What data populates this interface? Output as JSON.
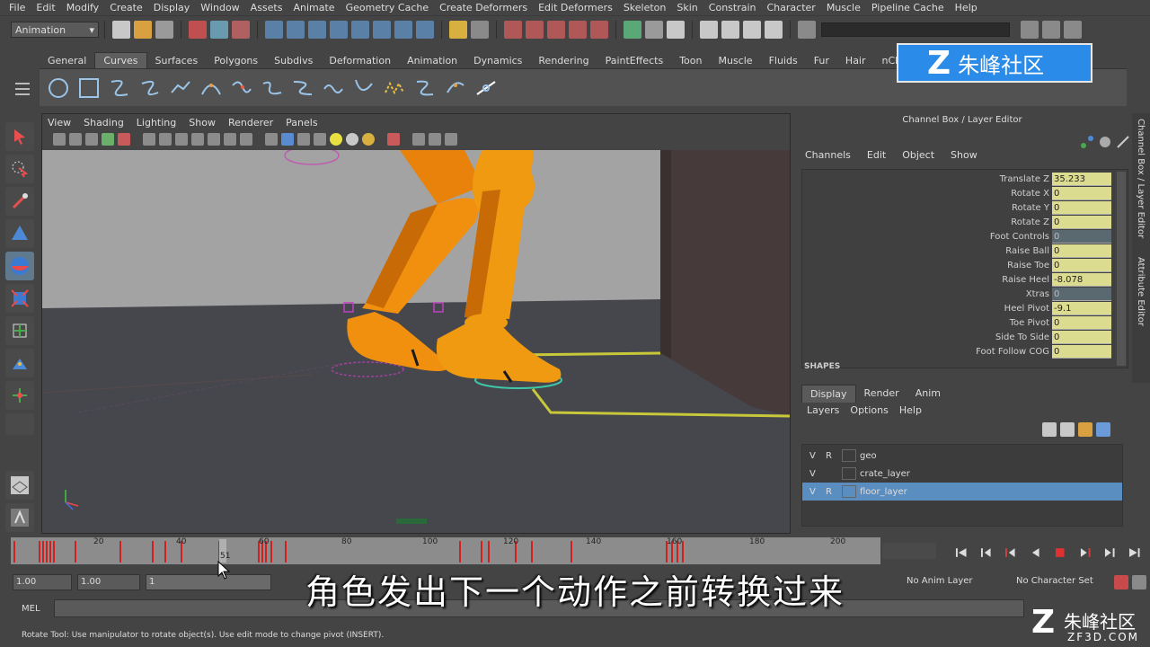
{
  "menubar": [
    "File",
    "Edit",
    "Modify",
    "Create",
    "Display",
    "Window",
    "Assets",
    "Animate",
    "Geometry Cache",
    "Create Deformers",
    "Edit Deformers",
    "Skeleton",
    "Skin",
    "Constrain",
    "Character",
    "Muscle",
    "Pipeline Cache",
    "Help"
  ],
  "statusline": {
    "mode": "Animation"
  },
  "shelf": {
    "tabs": [
      "General",
      "Curves",
      "Surfaces",
      "Polygons",
      "Subdivs",
      "Deformation",
      "Animation",
      "Dynamics",
      "Rendering",
      "PaintEffects",
      "Toon",
      "Muscle",
      "Fluids",
      "Fur",
      "Hair",
      "nClo"
    ],
    "active_tab": "Curves"
  },
  "logo": {
    "glyph": "Z",
    "text": "朱峰社区"
  },
  "viewport": {
    "menu": [
      "View",
      "Shading",
      "Lighting",
      "Show",
      "Renderer",
      "Panels"
    ]
  },
  "channel_box": {
    "title": "Channel Box / Layer Editor",
    "menu": [
      "Channels",
      "Edit",
      "Object",
      "Show"
    ],
    "attributes": [
      {
        "name": "Translate Z",
        "value": "35.233",
        "style": "key"
      },
      {
        "name": "Rotate X",
        "value": "0",
        "style": "key"
      },
      {
        "name": "Rotate Y",
        "value": "0",
        "style": "key"
      },
      {
        "name": "Rotate Z",
        "value": "0",
        "style": "key"
      },
      {
        "name": "Foot Controls",
        "value": "0",
        "style": "locked"
      },
      {
        "name": "Raise Ball",
        "value": "0",
        "style": "key"
      },
      {
        "name": "Raise Toe",
        "value": "0",
        "style": "key"
      },
      {
        "name": "Raise Heel",
        "value": "-8.078",
        "style": "key"
      },
      {
        "name": "Xtras",
        "value": "0",
        "style": "locked"
      },
      {
        "name": "Heel Pivot",
        "value": "-9.1",
        "style": "key"
      },
      {
        "name": "Toe Pivot",
        "value": "0",
        "style": "key"
      },
      {
        "name": "Side To Side",
        "value": "0",
        "style": "key"
      },
      {
        "name": "Foot Follow COG",
        "value": "0",
        "style": "key"
      }
    ],
    "shapes_label": "SHAPES"
  },
  "layer_editor": {
    "tabs": [
      "Display",
      "Render",
      "Anim"
    ],
    "active_tab": "Display",
    "menu": [
      "Layers",
      "Options",
      "Help"
    ],
    "layers": [
      {
        "v": "V",
        "r": "R",
        "name": "geo",
        "selected": false
      },
      {
        "v": "V",
        "r": "",
        "name": "crate_layer",
        "selected": false
      },
      {
        "v": "V",
        "r": "R",
        "name": "floor_layer",
        "selected": true
      }
    ]
  },
  "side_tabs": [
    "Channel Box / Layer Editor",
    "Attribute Editor"
  ],
  "timeslider": {
    "ticks": [
      "20",
      "40",
      "60",
      "80",
      "100",
      "120",
      "140",
      "160",
      "180",
      "200"
    ],
    "current_frame": "51"
  },
  "rangebar": {
    "start": "1.00",
    "playback_start": "1.00",
    "range_start": "1",
    "anim_layer": "No Anim Layer",
    "character_set": "No Character Set"
  },
  "cmdline": {
    "label": "MEL"
  },
  "helpline": "Rotate Tool: Use manipulator to rotate object(s). Use edit mode to change pivot (INSERT).",
  "subtitle": "角色发出下一个动作之前转换过来",
  "watermark": {
    "glyph": "Z",
    "text": "朱峰社区",
    "domain": "ZF3D.COM"
  }
}
